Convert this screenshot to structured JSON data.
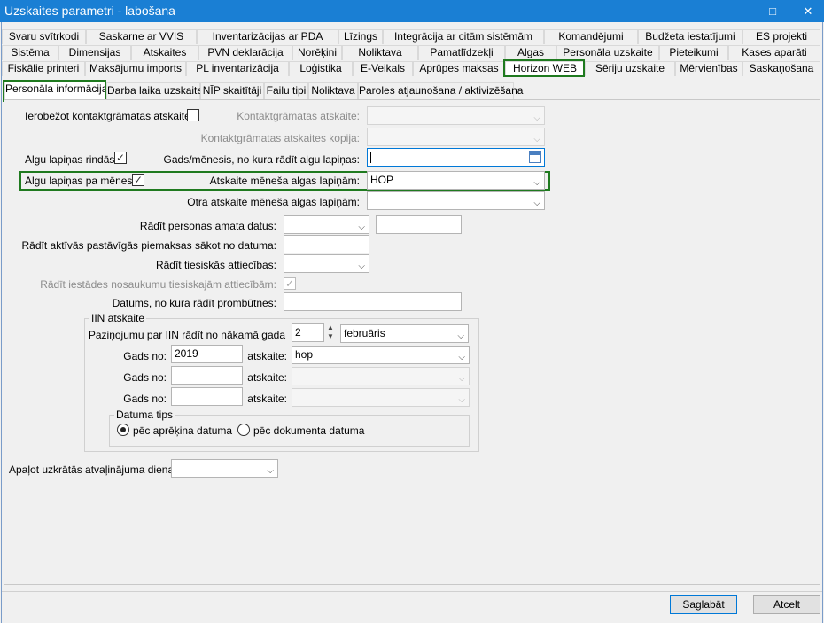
{
  "window": {
    "title": "Uzskaites parametri - labošana",
    "minimize_icon": "–",
    "maximize_icon": "□",
    "close_icon": "✕"
  },
  "top_tabs_row1": [
    "Svaru svītrkodi",
    "Saskarne ar VVIS",
    "Inventarizācijas ar PDA",
    "Līzings",
    "Integrācija ar citām sistēmām",
    "Komandējumi",
    "Budžeta iestatījumi",
    "ES projekti"
  ],
  "top_tabs_row2": [
    "Sistēma",
    "Dimensijas",
    "Atskaites",
    "PVN deklarācija",
    "Norēķini",
    "Noliktava",
    "Pamatlīdzekļi",
    "Algas",
    "Personāla uzskaite",
    "Pieteikumi",
    "Kases aparāti"
  ],
  "top_tabs_row3": [
    "Fiskālie printeri",
    "Maksājumu imports",
    "PL inventarizācija",
    "Loģistika",
    "E-Veikals",
    "Aprūpes maksas",
    "Horizon WEB",
    "Sēriju uzskaite",
    "Mērvienības",
    "Saskaņošana"
  ],
  "sub_tabs": [
    "Personāla informācija",
    "Darba laika uzskaite",
    "NĪP skaitītāji",
    "Failu tipi",
    "Noliktava",
    "Paroles atjaunošana / aktivizēšana"
  ],
  "form": {
    "limit_contact_label": "Ierobežot kontaktgrāmatas atskaites:",
    "contact_report_label": "Kontaktgrāmatas atskaite:",
    "contact_report_copy_label": "Kontaktgrāmatas atskaites kopija:",
    "payslips_rows_label": "Algu lapiņas rindās:",
    "payslips_rows_checked": "✓",
    "year_month_label": "Gads/mēnesis, no kura rādīt algu lapiņas:",
    "payslips_monthly_label": "Algu lapiņas pa mēnesi:",
    "payslips_monthly_checked": "✓",
    "monthly_report_label": "Atskaite mēneša algas lapiņām:",
    "monthly_report_value": "HOP",
    "second_report_label": "Otra atskaite mēneša algas lapiņām:",
    "show_position_label": "Rādīt personas amata datus:",
    "show_allowance_label": "Rādīt aktīvās pastāvīgās piemaksas sākot no datuma:",
    "show_legal_label": "Rādīt tiesiskās attiecības:",
    "show_institution_label": "Rādīt iestādes nosaukumu tiesiskajām attiecībām:",
    "show_institution_checked": "✓",
    "absence_date_label": "Datums, no kura rādīt prombūtnes:",
    "iin_group": "IIN atskaite",
    "iin_notice_label": "Paziņojumu par IIN rādīt no nākamā gada",
    "iin_notice_value": "2",
    "iin_month_value": "februāris",
    "year_label": "Gads no:",
    "report_label": "atskaite:",
    "year1": "2019",
    "report1": "hop",
    "date_type_group": "Datuma tips",
    "radio_calc": "pēc aprēķina datuma",
    "radio_doc": "pēc dokumenta datuma",
    "round_vacation_label": "Apaļot uzkrātās atvaļinājuma dienas:"
  },
  "buttons": {
    "save": "Saglabāt",
    "cancel": "Atcelt"
  },
  "icons": {
    "dropdown": "⌵",
    "spin_up": "▲",
    "spin_down": "▼"
  },
  "colors": {
    "titlebar": "#1a7fd4",
    "highlight": "#1f7a1f"
  }
}
